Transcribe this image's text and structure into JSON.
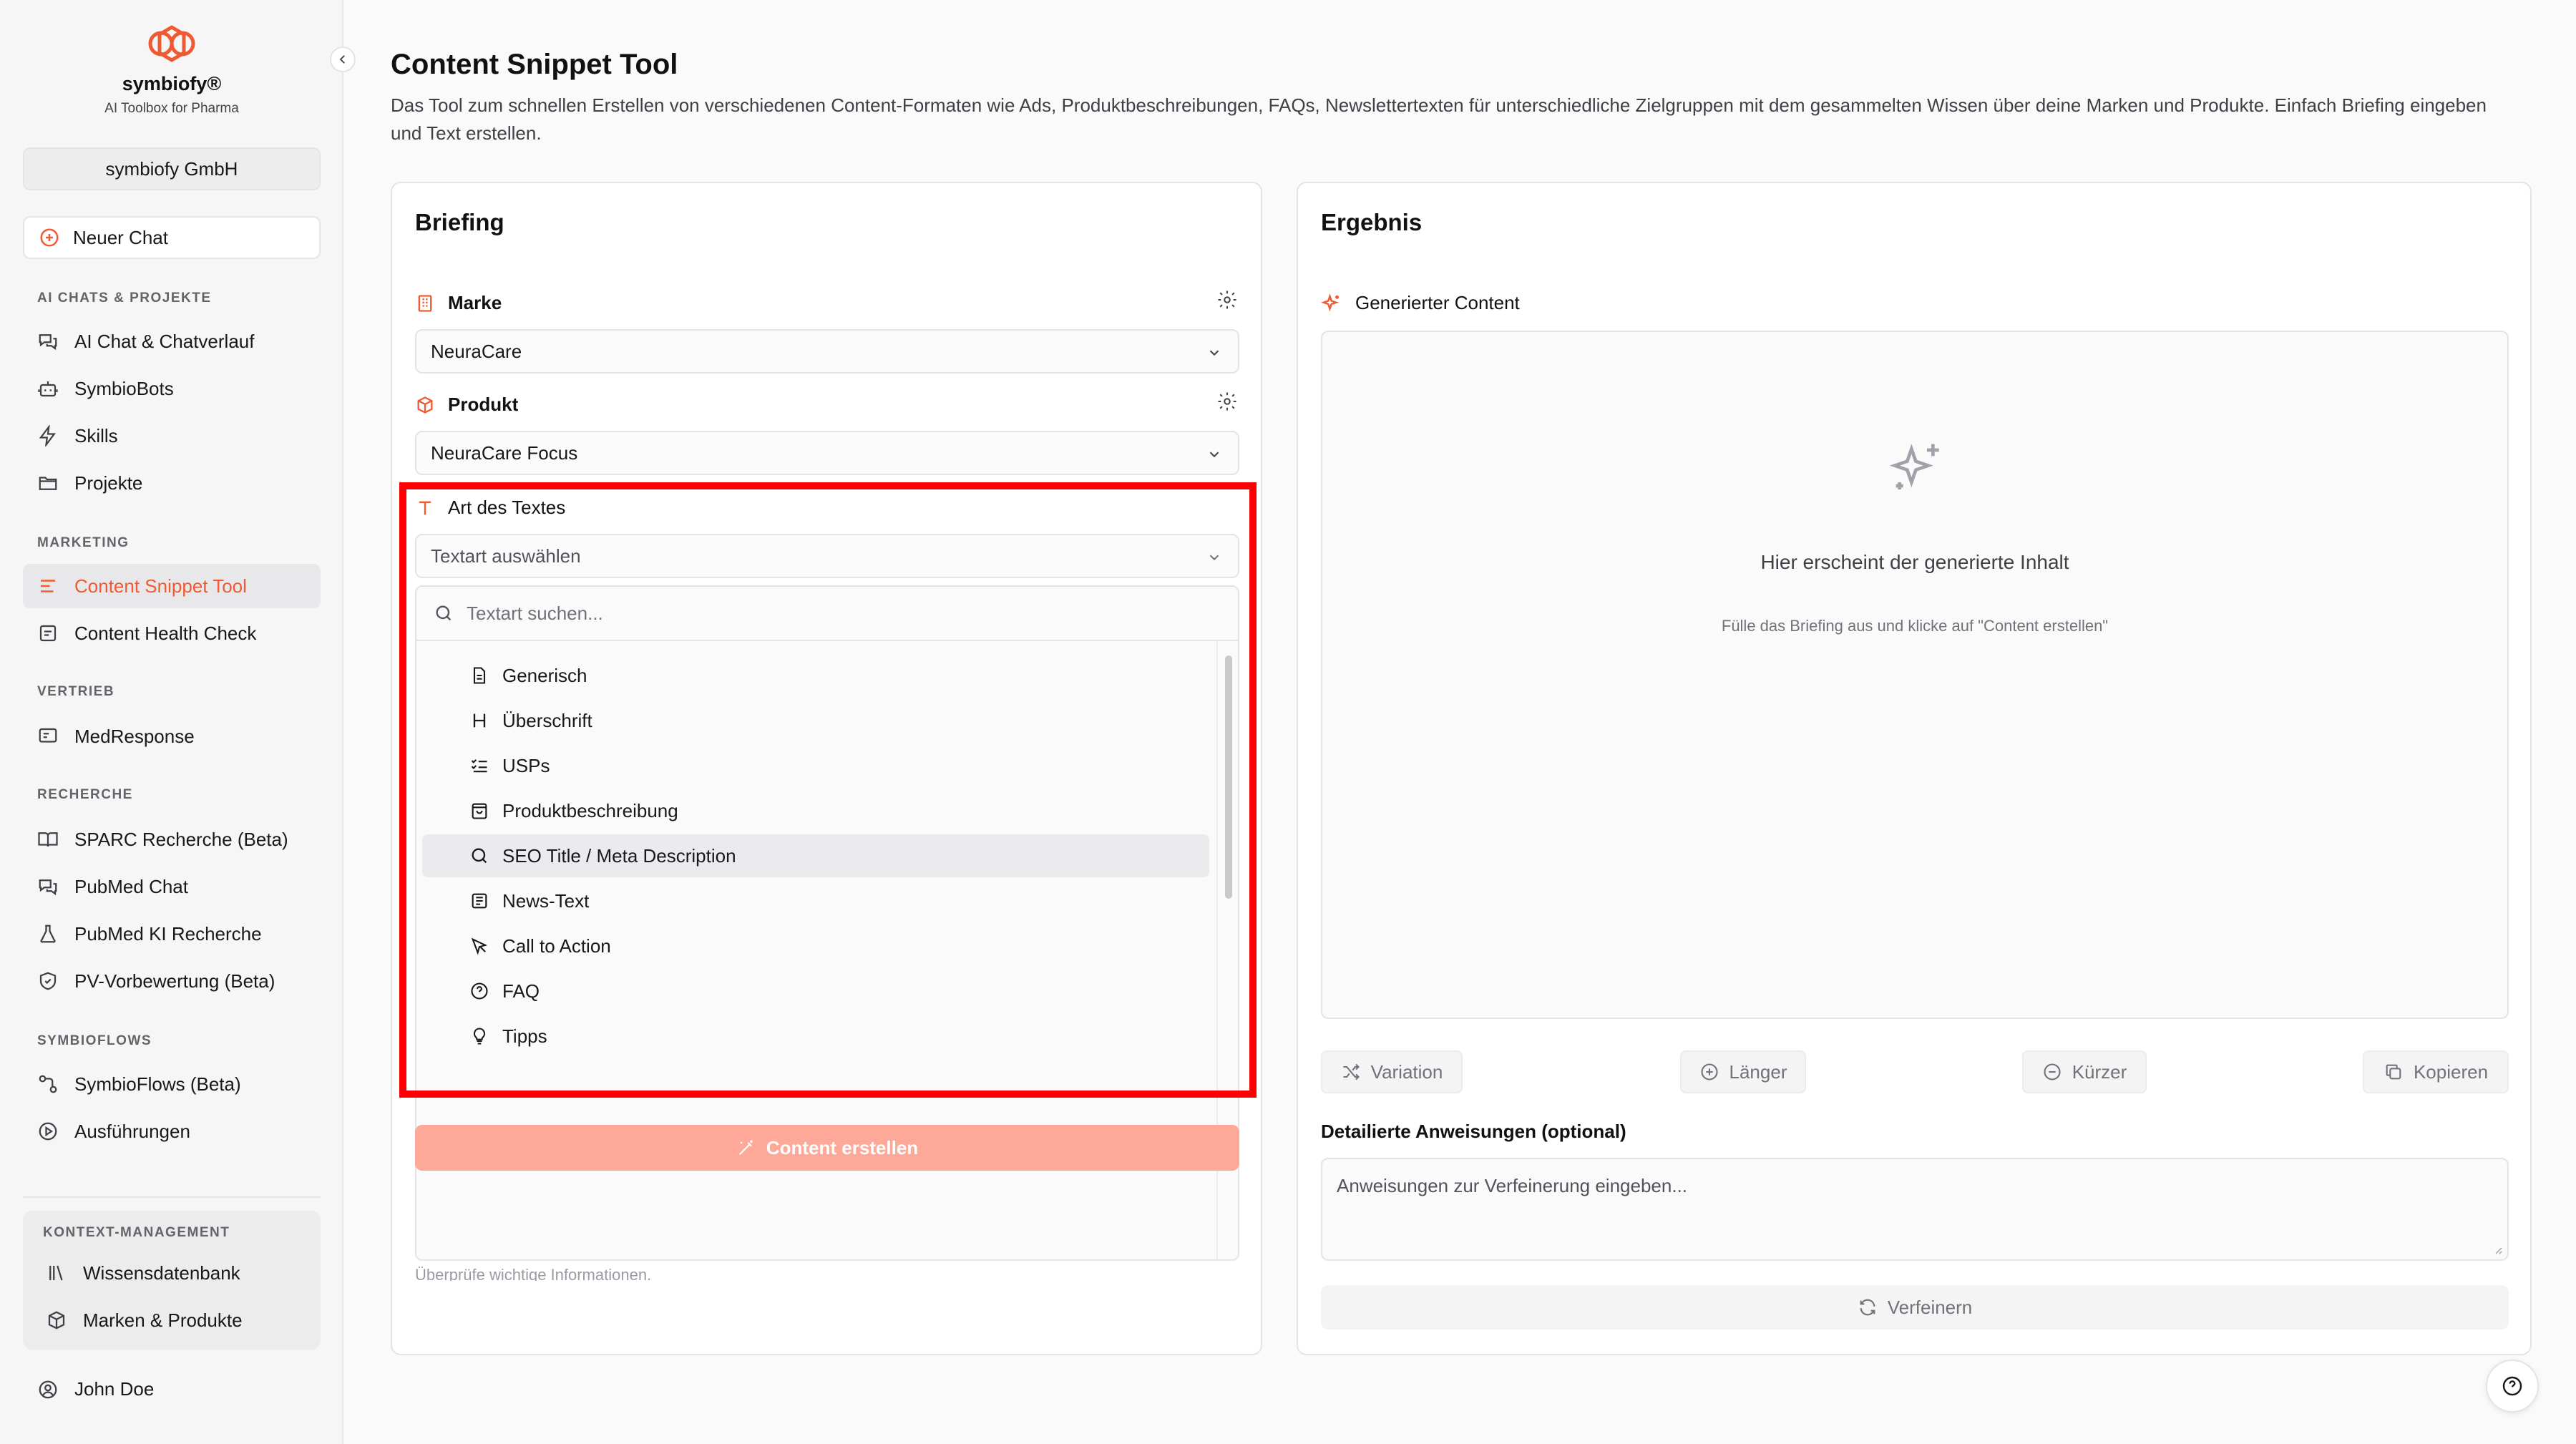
{
  "sidebar": {
    "brand_name": "symbiofy®",
    "brand_sub": "AI Toolbox for Pharma",
    "org": "symbiofy GmbH",
    "new_chat": "Neuer Chat",
    "sections": [
      {
        "title": "AI CHATS & PROJEKTE",
        "items": [
          "AI Chat & Chatverlauf",
          "SymbioBots",
          "Skills",
          "Projekte"
        ]
      },
      {
        "title": "MARKETING",
        "items": [
          "Content Snippet Tool",
          "Content Health Check"
        ]
      },
      {
        "title": "VERTRIEB",
        "items": [
          "MedResponse"
        ]
      },
      {
        "title": "RECHERCHE",
        "items": [
          "SPARC Recherche (Beta)",
          "PubMed Chat",
          "PubMed KI Recherche",
          "PV-Vorbewertung (Beta)"
        ]
      },
      {
        "title": "SYMBIOFLOWS",
        "items": [
          "SymbioFlows (Beta)",
          "Ausführungen"
        ]
      },
      {
        "title": "KONTEXT-MANAGEMENT",
        "items": [
          "Wissensdatenbank",
          "Marken & Produkte"
        ]
      }
    ],
    "user": "John Doe"
  },
  "header": {
    "title": "Content Snippet Tool",
    "description": "Das Tool zum schnellen Erstellen von verschiedenen Content-Formaten wie Ads, Produktbeschreibungen, FAQs, Newslettertexten für unterschiedliche Zielgruppen mit dem gesammelten Wissen über deine Marken und Produkte. Einfach Briefing eingeben und Text erstellen."
  },
  "briefing": {
    "title": "Briefing",
    "marke_label": "Marke",
    "marke_value": "NeuraCare",
    "produkt_label": "Produkt",
    "produkt_value": "NeuraCare Focus",
    "art_label": "Art des Textes",
    "art_placeholder": "Textart auswählen",
    "search_placeholder": "Textart suchen...",
    "options": [
      "Generisch",
      "Überschrift",
      "USPs",
      "Produktbeschreibung",
      "SEO Title / Meta Description",
      "News-Text",
      "Call to Action",
      "FAQ",
      "Tipps"
    ],
    "disclaimer": "Bitte gib keine sensiblen oder personenbezogenen Daten ein. Die künstliche Intelligenz kann Fehler machen. Überprüfe wichtige Informationen.",
    "create_button": "Content erstellen"
  },
  "ergebnis": {
    "title": "Ergebnis",
    "generated_label": "Generierter Content",
    "empty_title": "Hier erscheint der generierte Inhalt",
    "empty_sub": "Fülle das Briefing aus und klicke auf \"Content erstellen\"",
    "actions": [
      "Variation",
      "Länger",
      "Kürzer",
      "Kopieren"
    ],
    "instructions_label": "Detailierte Anweisungen (optional)",
    "instructions_placeholder": "Anweisungen zur Verfeinerung eingeben...",
    "refine_button": "Verfeinern"
  },
  "colors": {
    "accent": "#f05a32",
    "highlight": "#ff0000",
    "button_disabled": "#fda898"
  }
}
